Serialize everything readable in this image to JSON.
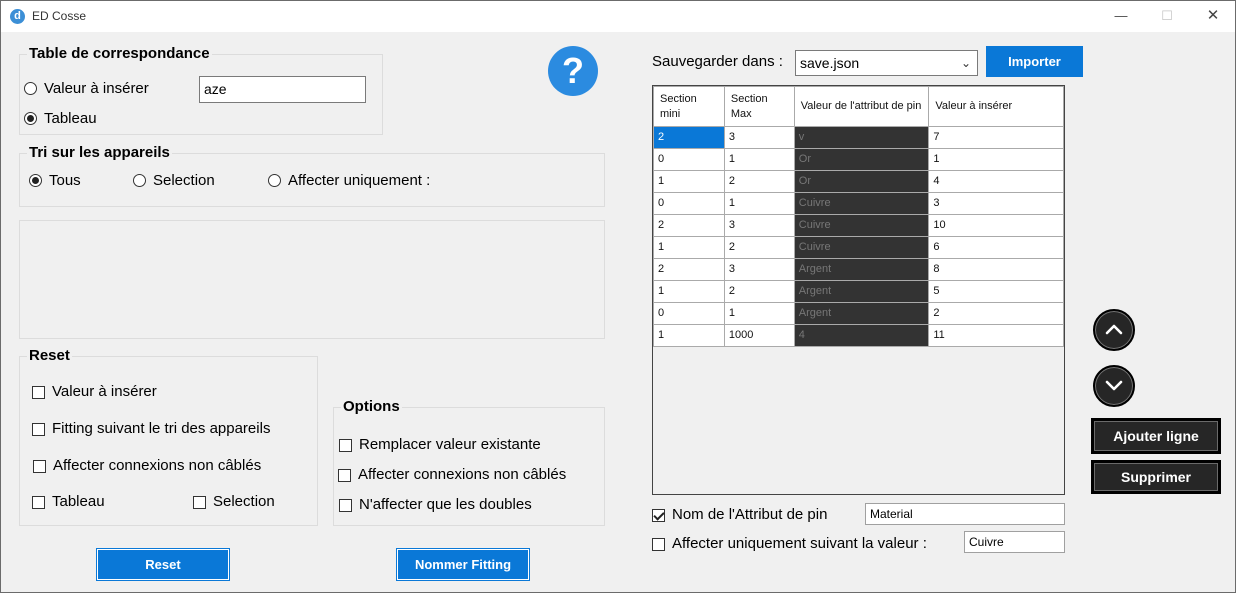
{
  "window": {
    "title": "ED Cosse",
    "app_icon": "d"
  },
  "help_glyph": "?",
  "correspondance": {
    "title": "Table de correspondance",
    "option_value_label": "Valeur à insérer",
    "option_table_label": "Tableau",
    "value_input": "aze"
  },
  "tri": {
    "title": "Tri sur les appareils",
    "opt_all": "Tous",
    "opt_selection": "Selection",
    "opt_only": "Affecter uniquement :"
  },
  "reset_group": {
    "title": "Reset",
    "cb_value": "Valeur à insérer",
    "cb_fitting": "Fitting suivant le tri des appareils",
    "cb_connexions": "Affecter connexions non câblés",
    "cb_table": "Tableau",
    "cb_selection": "Selection"
  },
  "options_group": {
    "title": "Options",
    "cb_replace": "Remplacer valeur existante",
    "cb_connexions": "Affecter connexions non câblés",
    "cb_doubles": "N'affecter que les doubles"
  },
  "buttons": {
    "reset": "Reset",
    "nommer": "Nommer Fitting",
    "importer": "Importer",
    "ajouter": "Ajouter ligne",
    "supprimer": "Supprimer"
  },
  "save": {
    "label": "Sauvegarder dans :",
    "value": "save.json"
  },
  "table": {
    "headers": [
      "Section mini",
      "Section Max",
      "Valeur de l'attribut de pin",
      "Valeur à insérer"
    ],
    "rows": [
      [
        "2",
        "3",
        "v",
        "7"
      ],
      [
        "0",
        "1",
        "Or",
        "1"
      ],
      [
        "1",
        "2",
        "Or",
        "4"
      ],
      [
        "0",
        "1",
        "Cuivre",
        "3"
      ],
      [
        "2",
        "3",
        "Cuivre",
        "10"
      ],
      [
        "1",
        "2",
        "Cuivre",
        "6"
      ],
      [
        "2",
        "3",
        "Argent",
        "8"
      ],
      [
        "1",
        "2",
        "Argent",
        "5"
      ],
      [
        "0",
        "1",
        "Argent",
        "2"
      ],
      [
        "1",
        "1000",
        "4",
        "11"
      ]
    ]
  },
  "attr": {
    "name_label": "Nom de l'Attribut de pin",
    "name_value": "Material",
    "only_label": "Affecter uniquement suivant la valeur :",
    "only_value": "Cuivre"
  },
  "colors": {
    "accent": "#0a78d7",
    "dark": "#262626",
    "dark_cell": "#333333"
  }
}
